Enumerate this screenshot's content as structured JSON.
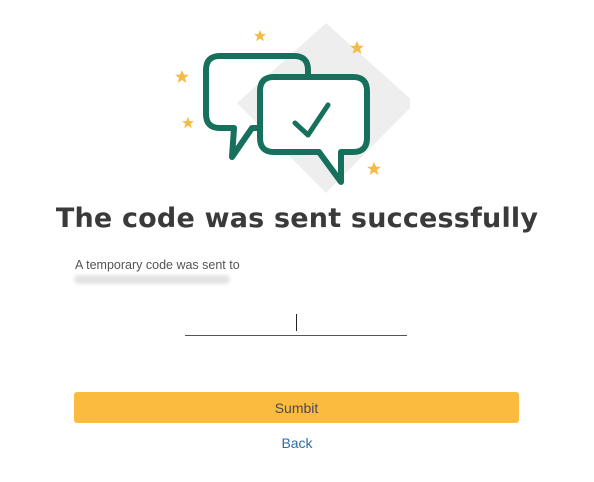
{
  "header": {
    "title": "The code was sent successfully",
    "subtitle": "A temporary code was sent to"
  },
  "form": {
    "code_value": "",
    "submit_label": "Sumbit",
    "back_label": "Back"
  },
  "icons": {
    "illustration": "chat-bubbles-checkmark-icon",
    "decoration": "star-icon"
  },
  "colors": {
    "accent": "#fbbb3f",
    "icon_stroke": "#16705c",
    "star": "#f5bb47",
    "link": "#2e6da4",
    "title": "#3a3a3a"
  }
}
